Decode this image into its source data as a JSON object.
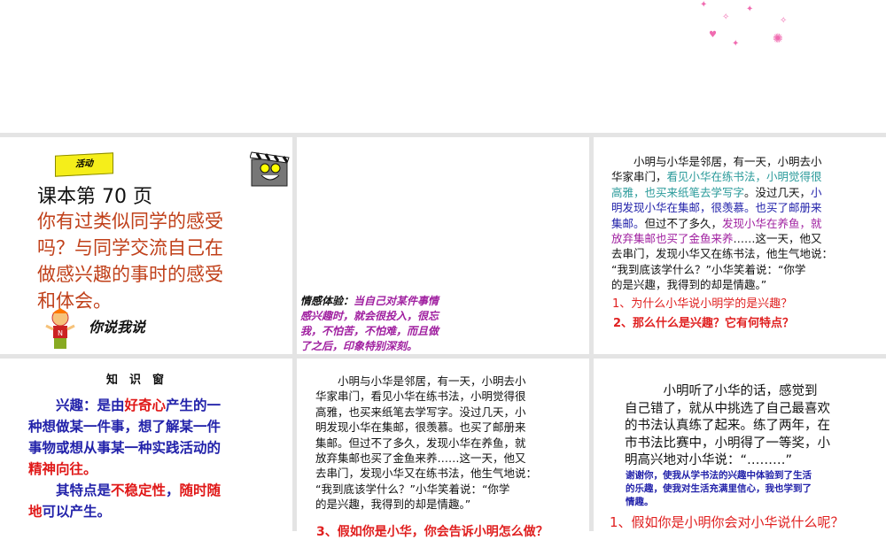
{
  "colors": {
    "black": "#111111",
    "red": "#cc2a1a",
    "teal": "#2a9a9a",
    "blue": "#2222aa",
    "purple": "#a020a0",
    "brightred": "#e01818",
    "orange": "#c0401a"
  },
  "p1": {
    "banner": "活动",
    "title": "课本第 70 页",
    "prompt": [
      "你有过类似同学的感受",
      "吗？与同学交流自己在",
      "做感兴趣的事时的感受",
      "和体会。"
    ],
    "caption": "你说我说"
  },
  "p2": {
    "lines": [
      [
        {
          "t": "情感体验：",
          "c": "black"
        },
        {
          "t": "当自己对某件事情",
          "c": "purple"
        }
      ],
      [
        {
          "t": "感兴趣时，就会很投入，很忘",
          "c": "purple"
        }
      ],
      [
        {
          "t": "我，不怕苦，不怕难，而且做",
          "c": "purple"
        }
      ],
      [
        {
          "t": "了之后，印象特别深刻。",
          "c": "purple"
        }
      ]
    ]
  },
  "p3": {
    "lines": [
      [
        {
          "t": "　　小明与小华是邻居，有一天，小明去小",
          "c": "black"
        }
      ],
      [
        {
          "t": "华家串门，",
          "c": "black"
        },
        {
          "t": "看见小华在练书法，小明觉得很",
          "c": "teal"
        }
      ],
      [
        {
          "t": "高雅，也买来纸笔去学写字",
          "c": "teal"
        },
        {
          "t": "。没过几天，",
          "c": "black"
        },
        {
          "t": "小",
          "c": "blue"
        }
      ],
      [
        {
          "t": "明发现小华在集邮，很羡慕。也买了邮册来",
          "c": "blue"
        }
      ],
      [
        {
          "t": "集邮。",
          "c": "blue"
        },
        {
          "t": "但过不了多久，",
          "c": "black"
        },
        {
          "t": "发现小华在养鱼，就",
          "c": "purple"
        }
      ],
      [
        {
          "t": "放弃集邮也买了金鱼来养",
          "c": "purple"
        },
        {
          "t": "……这一天，他又",
          "c": "black"
        }
      ],
      [
        {
          "t": "去串门，发现小华又在练书法，他生气地说：",
          "c": "black"
        }
      ],
      [
        {
          "t": "“我到底该学什么？”小华笑着说：“你学",
          "c": "black"
        }
      ],
      [
        {
          "t": "的是兴趣，我得到的却是情趣。”",
          "c": "black"
        }
      ]
    ],
    "q1": "1、为什么小华说小明学的是兴趣？",
    "q2": "2、那么什么是兴趣？它有何特点？"
  },
  "p4": {
    "heading": "知　识　窗",
    "lines": [
      [
        {
          "t": "　　兴趣：是由",
          "c": "blue"
        },
        {
          "t": "好奇心",
          "c": "brightred"
        },
        {
          "t": "产生的一",
          "c": "blue"
        }
      ],
      [
        {
          "t": "种想做某一件事，想了解某一件",
          "c": "blue"
        }
      ],
      [
        {
          "t": "事物或想从事某一种实践活动的",
          "c": "blue"
        }
      ],
      [
        {
          "t": "精神向往。",
          "c": "brightred"
        }
      ],
      [
        {
          "t": "　　其特点是",
          "c": "blue"
        },
        {
          "t": "不稳定性",
          "c": "brightred"
        },
        {
          "t": "，",
          "c": "blue"
        },
        {
          "t": "随时随",
          "c": "brightred"
        }
      ],
      [
        {
          "t": "地",
          "c": "brightred"
        },
        {
          "t": "可以产生。",
          "c": "blue"
        }
      ]
    ]
  },
  "p5": {
    "lines": [
      [
        {
          "t": "　　小明与小华是邻居，有一天，小明去小",
          "c": "black"
        }
      ],
      [
        {
          "t": "华家串门，看见小华在练书法，小明觉得很",
          "c": "black"
        }
      ],
      [
        {
          "t": "高雅，也买来纸笔去学写字。没过几天，小",
          "c": "black"
        }
      ],
      [
        {
          "t": "明发现小华在集邮，很羡慕。也买了邮册来",
          "c": "black"
        }
      ],
      [
        {
          "t": "集邮。但过不了多久，发现小华在养鱼，就",
          "c": "black"
        }
      ],
      [
        {
          "t": "放弃集邮也买了金鱼来养……这一天，他又",
          "c": "black"
        }
      ],
      [
        {
          "t": "去串门，发现小华又在练书法，他生气地说：",
          "c": "black"
        }
      ],
      [
        {
          "t": "“我到底该学什么？”小华笑着说：“你学",
          "c": "black"
        }
      ],
      [
        {
          "t": "的是兴趣，我得到的却是情趣。”",
          "c": "black"
        }
      ]
    ],
    "q3": "3、假如你是小华，你会告诉小明怎么做？"
  },
  "p6": {
    "lines": [
      [
        {
          "t": "　　　小明听了小华的话，感觉到",
          "c": "black"
        }
      ],
      [
        {
          "t": "自己错了，就从中挑选了自己最喜欢",
          "c": "black"
        }
      ],
      [
        {
          "t": "的书法认真练了起来。练了两年，在",
          "c": "black"
        }
      ],
      [
        {
          "t": "市书法比赛中，小明得了一等奖，小",
          "c": "black"
        }
      ],
      [
        {
          "t": "明高兴地对小华说：“………”",
          "c": "black"
        }
      ]
    ],
    "answer": [
      "谢谢你，使我从学书法的兴趣中体验到了生活",
      "的乐趣，使我对生活充满里信心，我也学到了",
      "情趣。"
    ],
    "q": "1、假如你是小明你会对小华说什么呢？"
  }
}
